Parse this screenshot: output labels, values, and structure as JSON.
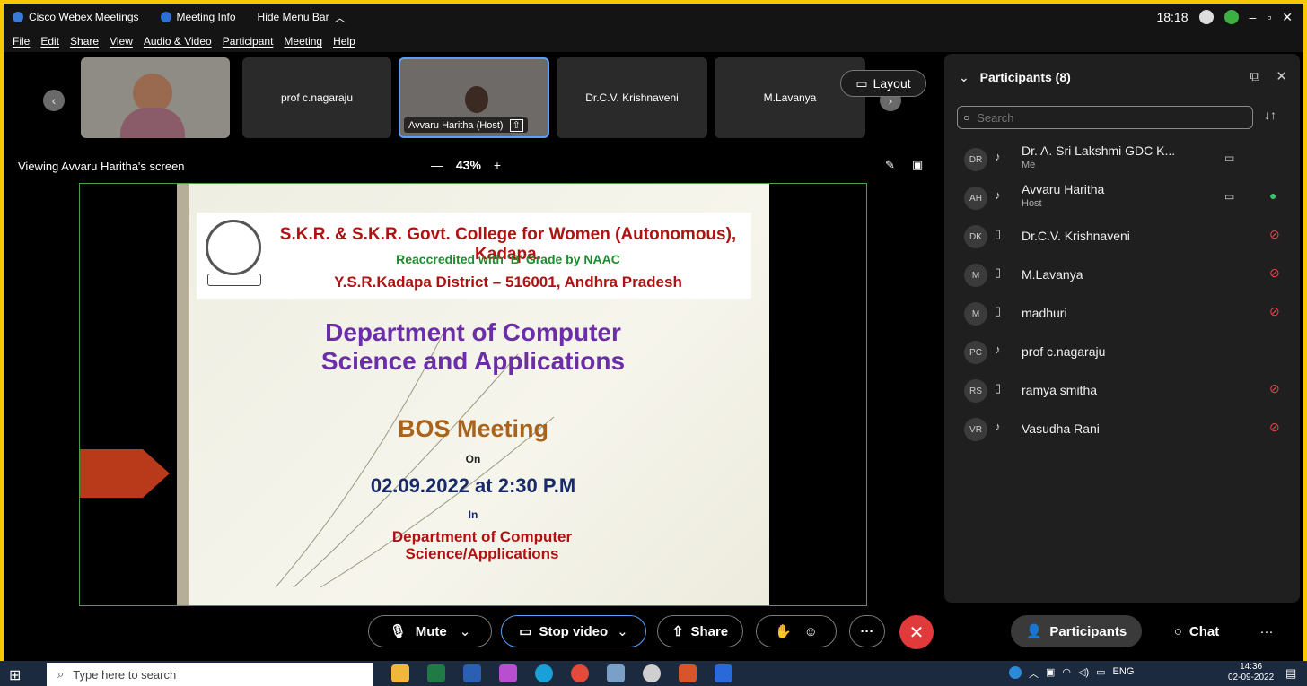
{
  "titlebar": {
    "app_name": "Cisco Webex Meetings",
    "meeting_info": "Meeting Info",
    "hide_menu": "Hide Menu Bar",
    "time": "18:18"
  },
  "menu": [
    "File",
    "Edit",
    "Share",
    "View",
    "Audio & Video",
    "Participant",
    "Meeting",
    "Help"
  ],
  "thumbs": {
    "items": [
      "prof c.nagaraju",
      "Dr.C.V. Krishnaveni",
      "M.Lavanya"
    ],
    "host_label": "Avvaru Haritha (Host)"
  },
  "layout_label": "Layout",
  "viewing_text": "Viewing Avvaru Haritha's screen",
  "zoom": "43%",
  "slide": {
    "college": "S.K.R. & S.K.R. Govt. College for Women (Autonomous), Kadapa.",
    "accreditation": "Reaccredited with ‘B’ Grade by NAAC",
    "district": "Y.S.R.Kadapa District – 516001, Andhra Pradesh",
    "dept_line1": "Department of Computer",
    "dept_line2": "Science and Applications",
    "event": "BOS Meeting",
    "on": "On",
    "date": "02.09.2022 at 2:30 P.M",
    "in": "In",
    "venue_line1": "Department of Computer",
    "venue_line2": "Science/Applications"
  },
  "panel": {
    "title": "Participants (8)",
    "search_placeholder": "Search",
    "participants": [
      {
        "initials": "DR",
        "name": "Dr. A. Sri Lakshmi GDC K...",
        "role": "Me",
        "mic": "none"
      },
      {
        "initials": "AH",
        "name": "Avvaru Haritha",
        "role": "Host",
        "mic": "active"
      },
      {
        "initials": "DK",
        "name": "Dr.C.V. Krishnaveni",
        "role": "",
        "mic": "muted"
      },
      {
        "initials": "M",
        "name": "M.Lavanya",
        "role": "",
        "mic": "muted"
      },
      {
        "initials": "M",
        "name": "madhuri",
        "role": "",
        "mic": "muted"
      },
      {
        "initials": "PC",
        "name": "prof c.nagaraju",
        "role": "",
        "mic": "none"
      },
      {
        "initials": "RS",
        "name": "ramya smitha",
        "role": "",
        "mic": "muted"
      },
      {
        "initials": "VR",
        "name": "Vasudha Rani",
        "role": "",
        "mic": "muted"
      }
    ]
  },
  "controls": {
    "mute": "Mute",
    "stop_video": "Stop video",
    "share": "Share",
    "participants": "Participants",
    "chat": "Chat"
  },
  "taskbar": {
    "search_placeholder": "Type here to search",
    "lang": "ENG",
    "time": "14:36",
    "date": "02-09-2022"
  },
  "colors": {
    "accent_blue": "#5aa0ff",
    "end_red": "#e03a3a",
    "muted_red": "#e04a4a",
    "active_green": "#3dc06a",
    "frame_yellow": "#f7c800"
  }
}
